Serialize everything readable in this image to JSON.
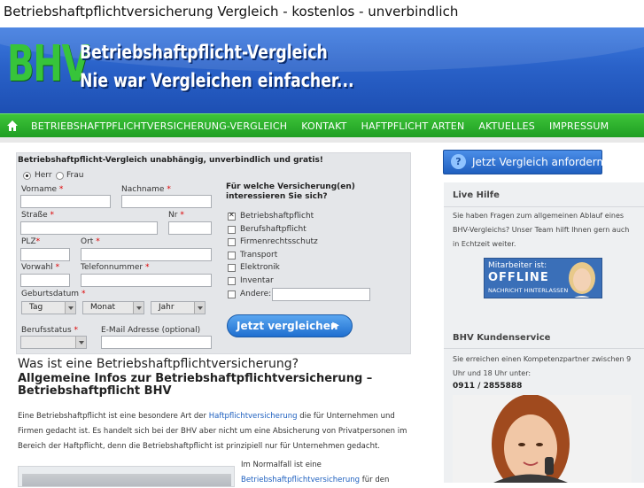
{
  "page": {
    "title": "Betriebshaftpflichtversicherung Vergleich - kostenlos - unverbindlich"
  },
  "header": {
    "logo_text": "BHV",
    "tagline_1": "Betriebshaftpflicht-Vergleich",
    "tagline_2": "Nie war Vergleichen einfacher..."
  },
  "nav": {
    "items": [
      {
        "label": "BETRIEBSHAFTPFLICHTVERSICHERUNG-VERGLEICH"
      },
      {
        "label": "KONTAKT"
      },
      {
        "label": "HAFTPFLICHT ARTEN"
      },
      {
        "label": "AKTUELLES"
      },
      {
        "label": "IMPRESSUM"
      }
    ]
  },
  "form": {
    "heading": "Betriebshaftpflicht-Vergleich unabhängig, unverbindlich und gratis!",
    "salutation": {
      "herr": "Herr",
      "frau": "Frau",
      "selected": "Herr"
    },
    "fields": {
      "vorname": "Vorname",
      "nachname": "Nachname",
      "strasse": "Straße",
      "nr": "Nr",
      "plz": "PLZ",
      "ort": "Ort",
      "vorwahl": "Vorwahl",
      "telefon": "Telefonnummer",
      "geburtsdatum": "Geburtsdatum",
      "berufsstatus": "Berufsstatus",
      "email": "E-Mail Adresse (optional)"
    },
    "required_mark": "*",
    "date_selects": {
      "tag": "Tag",
      "monat": "Monat",
      "jahr": "Jahr"
    },
    "question": "Für welche Versicherung(en) interessieren Sie sich?",
    "options": [
      {
        "label": "Betriebshaftpflicht",
        "checked": true
      },
      {
        "label": "Berufshaftpflicht",
        "checked": false
      },
      {
        "label": "Firmenrechtsschutz",
        "checked": false
      },
      {
        "label": "Transport",
        "checked": false
      },
      {
        "label": "Elektronik",
        "checked": false
      },
      {
        "label": "Inventar",
        "checked": false
      },
      {
        "label": "Andere:",
        "checked": false
      }
    ],
    "submit_label": "Jetzt vergleichen"
  },
  "article": {
    "h1": "Was ist eine Betriebshaftpflichtversicherung?",
    "h2": "Allgemeine Infos zur Betriebshaftpflichtversicherung – Betriebshaftpflicht BHV",
    "p1_a": "Eine Betriebshaftpflicht ist eine besondere Art der ",
    "p1_link": "Haftpflichtversicherung",
    "p1_b": " die für Unternehmen und Firmen gedacht ist. Es handelt sich bei der BHV aber nicht um eine Absicherung von Privatpersonen im Bereich der Haftpflicht, denn die Betriebshaftpflicht ist prinzipiell nur für Unternehmen gedacht.",
    "p2_a": "Im Normalfall ist eine ",
    "p2_link": "Betriebshaftpflichtversicherung",
    "p2_b": " für den"
  },
  "sidebar": {
    "cta_label": "Jetzt Vergleich anfordern",
    "live_help": {
      "title": "Live Hilfe",
      "text": "Sie haben Fragen zum allgemeinen Ablauf eines BHV-Vergleichs? Unser Team hilft Ihnen gern auch in Echtzeit weiter."
    },
    "status": {
      "line1": "Mitarbeiter ist:",
      "line2": "OFFLINE",
      "line3": "NACHRICHT HINTERLASSEN"
    },
    "service": {
      "title": "BHV Kundenservice",
      "text": "Sie erreichen einen Kompetenzpartner zwischen 9 Uhr und 18 Uhr unter:",
      "phone": "0911 / 2855888"
    }
  },
  "colors": {
    "banner_blue": "#2a62c9",
    "nav_green": "#1e9e22",
    "logo_green": "#37c43a",
    "link_blue": "#1d5fbf",
    "cta_blue": "#1f5fbf"
  }
}
